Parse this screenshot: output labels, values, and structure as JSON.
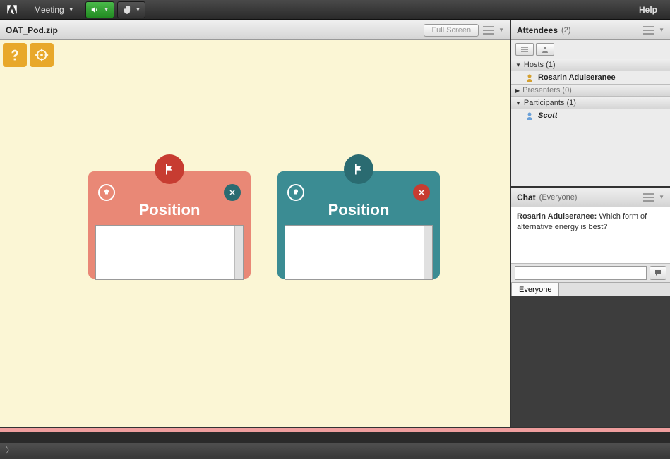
{
  "topbar": {
    "brand": "Adobe",
    "meeting_label": "Meeting",
    "help_label": "Help"
  },
  "share_pod": {
    "title": "OAT_Pod.zip",
    "fullscreen_label": "Full Screen"
  },
  "cards": {
    "red_title": "Position",
    "teal_title": "Position"
  },
  "attendees": {
    "title": "Attendees",
    "count": "(2)",
    "hosts_label": "Hosts (1)",
    "host_name": "Rosarin Adulseranee",
    "presenters_label": "Presenters (0)",
    "participants_label": "Participants (1)",
    "participant_name": "Scott"
  },
  "chat": {
    "title": "Chat",
    "scope": "(Everyone)",
    "sender": "Rosarin Adulseranee: ",
    "message": "Which form of alternative energy is best?",
    "tab_label": "Everyone"
  },
  "statusbar": {
    "prompt": "〉"
  }
}
